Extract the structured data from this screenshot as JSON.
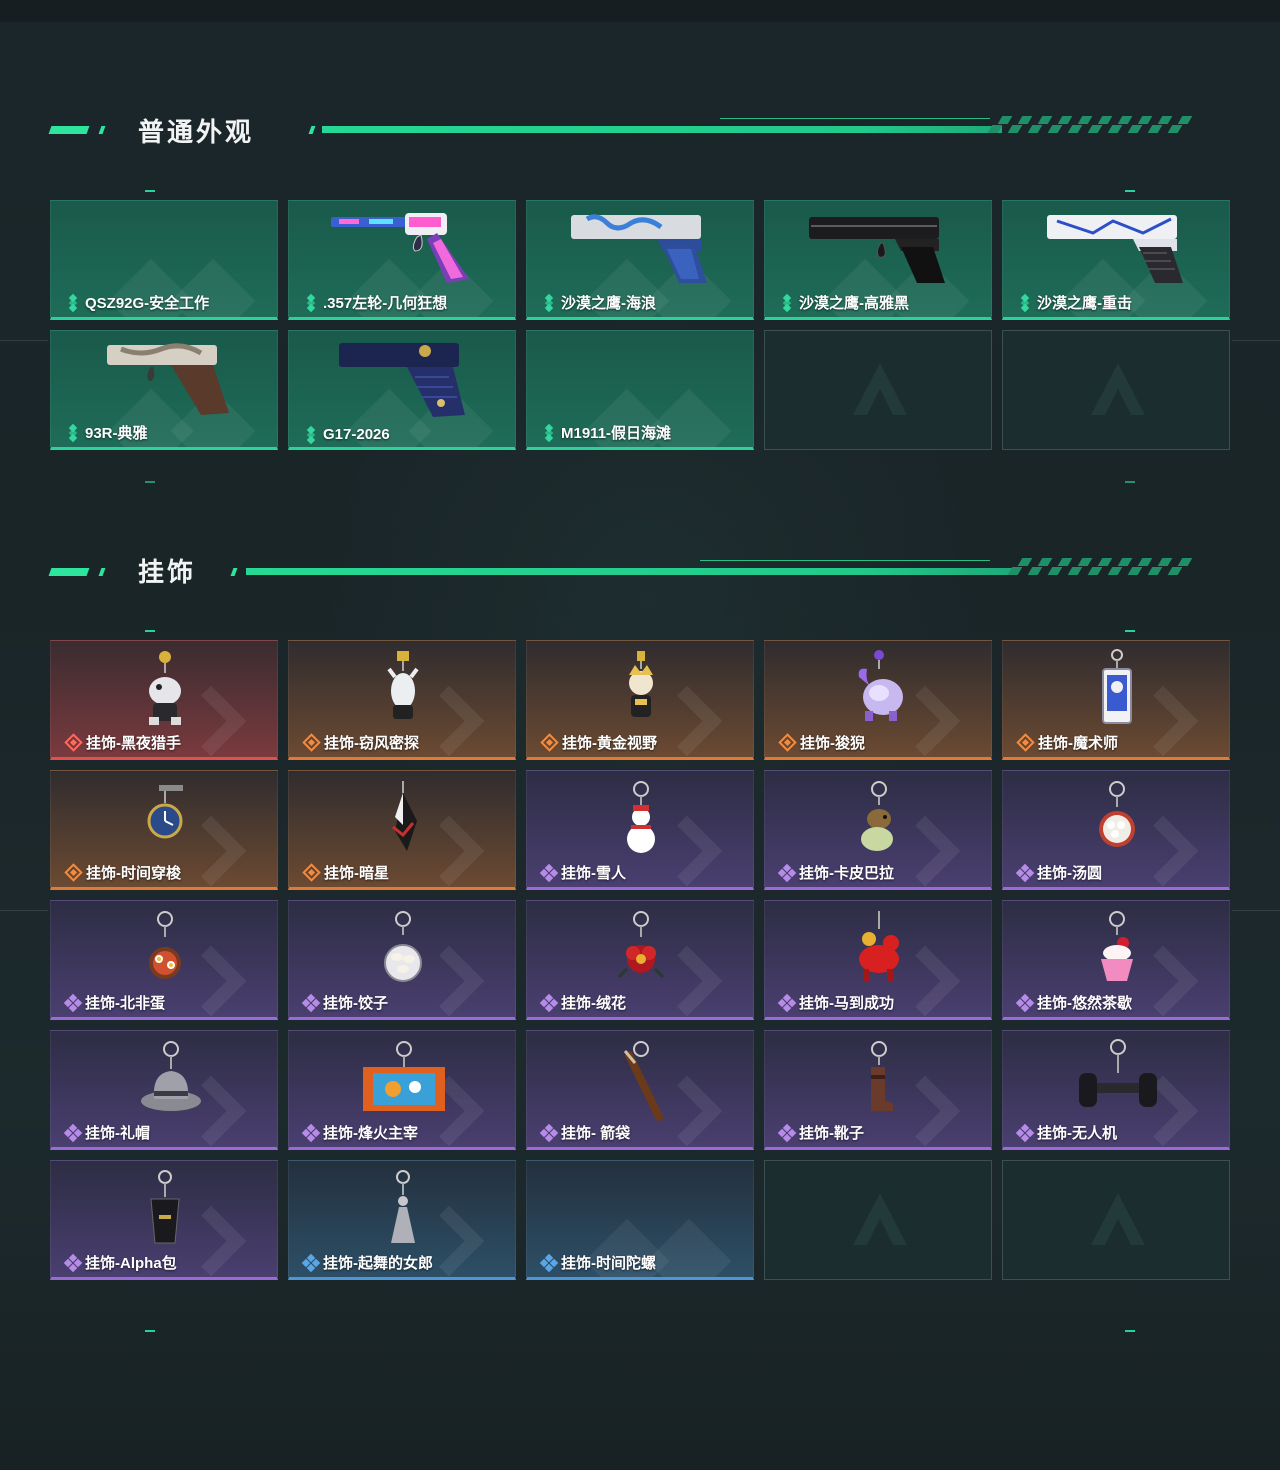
{
  "sections": {
    "skins": {
      "title": "普通外观"
    },
    "charms": {
      "title": "挂饰"
    }
  },
  "skins": [
    {
      "label": "QSZ92G-安全工作",
      "rarity": "green",
      "image": "none"
    },
    {
      "label": ".357左轮-几何狂想",
      "rarity": "green",
      "image": "revolver-icon"
    },
    {
      "label": "沙漠之鹰-海浪",
      "rarity": "green",
      "image": "desert-eagle-icon"
    },
    {
      "label": "沙漠之鹰-高雅黑",
      "rarity": "green",
      "image": "desert-eagle-icon"
    },
    {
      "label": "沙漠之鹰-重击",
      "rarity": "green",
      "image": "desert-eagle-icon"
    },
    {
      "label": "93R-典雅",
      "rarity": "green",
      "image": "pistol-icon"
    },
    {
      "label": "G17-2026",
      "rarity": "green",
      "image": "pistol-icon"
    },
    {
      "label": "M1911-假日海滩",
      "rarity": "green",
      "image": "none"
    },
    {
      "label": "",
      "rarity": "empty",
      "image": "empty-slot-logo-icon"
    },
    {
      "label": "",
      "rarity": "empty",
      "image": "empty-slot-logo-icon"
    }
  ],
  "charms": [
    {
      "label": "挂饰-黑夜猎手",
      "rarity": "red",
      "image": "charm-figure-icon"
    },
    {
      "label": "挂饰-窃风密探",
      "rarity": "orange",
      "image": "charm-figure-icon"
    },
    {
      "label": "挂饰-黄金视野",
      "rarity": "orange",
      "image": "charm-figure-icon"
    },
    {
      "label": "挂饰-狻猊",
      "rarity": "orange",
      "image": "charm-figure-icon"
    },
    {
      "label": "挂饰-魔术师",
      "rarity": "orange",
      "image": "charm-card-icon"
    },
    {
      "label": "挂饰-时间穿梭",
      "rarity": "orange",
      "image": "charm-clock-icon"
    },
    {
      "label": "挂饰-暗星",
      "rarity": "orange",
      "image": "charm-figure-icon"
    },
    {
      "label": "挂饰-雪人",
      "rarity": "purple",
      "image": "charm-snowman-icon"
    },
    {
      "label": "挂饰-卡皮巴拉",
      "rarity": "purple",
      "image": "charm-capybara-icon"
    },
    {
      "label": "挂饰-汤圆",
      "rarity": "purple",
      "image": "charm-bowl-icon"
    },
    {
      "label": "挂饰-北非蛋",
      "rarity": "purple",
      "image": "charm-bowl-icon"
    },
    {
      "label": "挂饰-饺子",
      "rarity": "purple",
      "image": "charm-bowl-icon"
    },
    {
      "label": "挂饰-绒花",
      "rarity": "purple",
      "image": "charm-flower-icon"
    },
    {
      "label": "挂饰-马到成功",
      "rarity": "purple",
      "image": "charm-horse-icon"
    },
    {
      "label": "挂饰-悠然茶歇",
      "rarity": "purple",
      "image": "charm-cake-icon"
    },
    {
      "label": "挂饰-礼帽",
      "rarity": "purple",
      "image": "charm-hat-icon"
    },
    {
      "label": "挂饰-烽火主宰",
      "rarity": "purple",
      "image": "charm-container-icon"
    },
    {
      "label": "挂饰- 箭袋",
      "rarity": "purple",
      "image": "charm-quiver-icon"
    },
    {
      "label": "挂饰-靴子",
      "rarity": "purple",
      "image": "charm-boot-icon"
    },
    {
      "label": "挂饰-无人机",
      "rarity": "purple",
      "image": "charm-drone-icon"
    },
    {
      "label": "挂饰-Alpha包",
      "rarity": "purple",
      "image": "charm-bag-icon"
    },
    {
      "label": "挂饰-起舞的女郎",
      "rarity": "blue",
      "image": "charm-dancer-icon"
    },
    {
      "label": "挂饰-时间陀螺",
      "rarity": "blue",
      "image": "none"
    },
    {
      "label": "",
      "rarity": "empty",
      "image": "empty-slot-logo-icon"
    },
    {
      "label": "",
      "rarity": "empty",
      "image": "empty-slot-logo-icon"
    }
  ],
  "colors": {
    "accent": "#2ee59e",
    "green_rarity": "#2bd39a",
    "red_rarity": "#e0504f",
    "orange_rarity": "#e07a36",
    "purple_rarity": "#9a6ad8",
    "blue_rarity": "#4d97d8"
  }
}
